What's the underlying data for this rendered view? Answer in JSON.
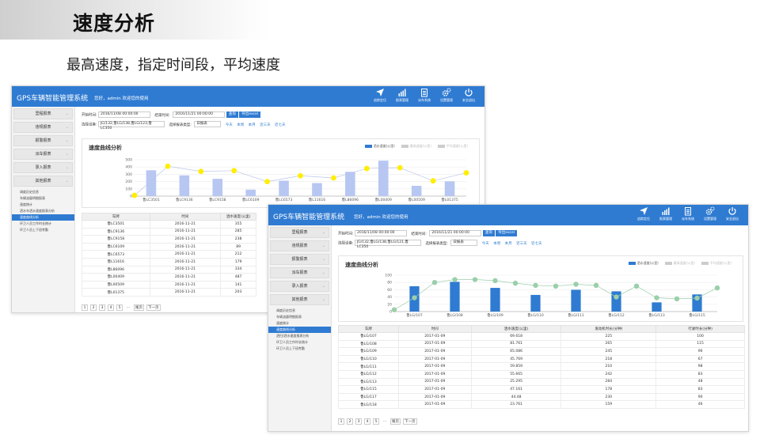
{
  "promo": {
    "title": "速度分析",
    "subtitle": "最高速度，指定时间段，平均速度"
  },
  "colors": {
    "header_blue": "#2f7bd2",
    "bar_light": "#b7c7f2",
    "bar_blue": "#2f7bd2",
    "dot_yellow": "#ffee00",
    "dot_green": "#9acfaa"
  },
  "back_app": {
    "brand": "GPS车辆智能管理系统",
    "welcome": "您好，admin 欢迎您的使用",
    "nav": [
      {
        "label": "追踪定位",
        "icon": "location-arrow-icon"
      },
      {
        "label": "报表管理",
        "icon": "bar-chart-icon"
      },
      {
        "label": "派车系统",
        "icon": "clipboard-icon"
      },
      {
        "label": "设置管理",
        "icon": "gears-icon"
      },
      {
        "label": "安全退出",
        "icon": "power-icon"
      }
    ],
    "menu": [
      "里程报表",
      "违规报表",
      "报警报表",
      "派车报表",
      "录入报表",
      "其他报表"
    ],
    "submenu": [
      "调度历史信息",
      "车辆油量明细报表",
      "速度统计",
      "洒水车洒水速度报表分析",
      "速度曲线分析",
      "环卫人员工作时长统计",
      "环卫人员上下班考勤"
    ],
    "active_submenu_index": 4,
    "filter": {
      "start_label": "开始时间:",
      "start_value": "2016/11/08 00:00:00",
      "end_label": "结束时间:",
      "end_value": "2016/11/21 00:00:00",
      "query_label": "查询",
      "export_label": "导出excel",
      "device_label": "选择设备:",
      "device_value": "JG/132,鲁LG/138,鲁LG/123,鲁LC350",
      "type_label": "选择报表类型:",
      "type_value": "日报表",
      "quick": [
        "今天",
        "本周",
        "本月",
        "近三天",
        "近七天"
      ]
    },
    "chart_title": "速度曲线分析",
    "legend": [
      "洒水速度(公里)",
      "最高速度(公里)",
      "平均速度(公里)"
    ],
    "table_headers": [
      "车牌",
      "时间",
      "洒水速度(公里)"
    ],
    "table_rows": [
      [
        "鲁LC3501",
        "2016-11-21",
        "355"
      ],
      [
        "鲁LC9136",
        "2016-11-21",
        "285"
      ],
      [
        "鲁LC9158",
        "2016-11-21",
        "238"
      ],
      [
        "鲁LC6109",
        "2016-11-21",
        "89"
      ],
      [
        "鲁LC6573",
        "2016-11-21",
        "212"
      ],
      [
        "鲁L11616",
        "2016-11-21",
        "179"
      ],
      [
        "鲁L86096",
        "2016-11-21",
        "334"
      ],
      [
        "鲁L00409",
        "2016-11-21",
        "487"
      ],
      [
        "鲁L00509",
        "2016-11-21",
        "141"
      ],
      [
        "鲁L01375",
        "2016-11-21",
        "203"
      ]
    ],
    "pager": [
      "1",
      "2",
      "3",
      "4",
      "5",
      "...",
      "尾页",
      "下一页"
    ]
  },
  "front_app": {
    "brand": "GPS车辆智能管理系统",
    "welcome": "您好，admin 欢迎您的使用",
    "nav": [
      {
        "label": "追踪定位",
        "icon": "location-arrow-icon"
      },
      {
        "label": "报表管理",
        "icon": "bar-chart-icon"
      },
      {
        "label": "派车系统",
        "icon": "clipboard-icon"
      },
      {
        "label": "设置管理",
        "icon": "gears-icon"
      },
      {
        "label": "安全退出",
        "icon": "power-icon"
      }
    ],
    "menu": [
      "里程报表",
      "违规报表",
      "报警报表",
      "派车报表",
      "录入报表",
      "其他报表"
    ],
    "submenu": [
      "调度历史信息",
      "车辆油量明细报表",
      "速度统计",
      "速度曲线分析",
      "洒扫/洒水速度报表分析",
      "环卫人员工作时长统计",
      "环卫人员上下班考勤"
    ],
    "active_submenu_index": 3,
    "filter": {
      "start_label": "开始时间:",
      "start_value": "2016/11/08 00:00:00",
      "end_label": "结束时间:",
      "end_value": "2016/11/21 00:00:00",
      "query_label": "查询",
      "export_label": "导出excel",
      "device_label": "选择设备:",
      "device_value": "JG/132,鲁LG/138,鲁LG/121,鲁LC350",
      "type_label": "选择报表类型:",
      "type_value": "日报表",
      "quick": [
        "今天",
        "本周",
        "本月",
        "近三天",
        "近七天"
      ]
    },
    "chart_title": "速度曲线分析",
    "legend": [
      "洒水速度(公里)",
      "最高速度(公里)",
      "平均速度(公里)"
    ],
    "table_headers": [
      "车牌",
      "时间",
      "洒水速度(公里)",
      "发动机时长(分钟)",
      "行驶时长(分钟)"
    ],
    "table_rows": [
      [
        "鲁LG/107",
        "2017-01-09",
        "69.618",
        "225",
        "100"
      ],
      [
        "鲁LG/108",
        "2017-01-09",
        "81.761",
        "265",
        "115"
      ],
      [
        "鲁LG/109",
        "2017-01-09",
        "65.086",
        "245",
        "96"
      ],
      [
        "鲁LG/110",
        "2017-01-09",
        "45.769",
        "218",
        "67"
      ],
      [
        "鲁LG/111",
        "2017-01-09",
        "59.859",
        "210",
        "98"
      ],
      [
        "鲁LG/112",
        "2017-01-09",
        "55.665",
        "242",
        "83"
      ],
      [
        "鲁LG/113",
        "2017-01-09",
        "25.295",
        "284",
        "48"
      ],
      [
        "鲁LG/115",
        "2017-01-09",
        "47.161",
        "178",
        "83"
      ],
      [
        "鲁LG/117",
        "2017-01-09",
        "44.48",
        "230",
        "90"
      ],
      [
        "鲁LG/118",
        "2017-01-09",
        "23.761",
        "159",
        "46"
      ]
    ],
    "pager": [
      "1",
      "2",
      "3",
      "4",
      "5",
      "...",
      "尾页",
      "下一页"
    ]
  },
  "chart_data": [
    {
      "type": "bar",
      "categories": [
        "鲁LC3501",
        "鲁LC9136",
        "鲁LC9158",
        "鲁LC6109",
        "鲁LC6573",
        "鲁L11616",
        "鲁L86096",
        "鲁L00409",
        "鲁L00509",
        "鲁L01375"
      ],
      "series": [
        {
          "name": "洒水速度(公里)",
          "values": [
            355,
            285,
            238,
            89,
            212,
            179,
            334,
            487,
            141,
            203
          ]
        }
      ],
      "markers": [
        10,
        410,
        340,
        350,
        200,
        280,
        250,
        380,
        390,
        210,
        320
      ],
      "ylim": [
        0,
        500
      ],
      "yticks": [
        0,
        100,
        200,
        300,
        400,
        500
      ],
      "legend": [
        "洒水速度(公里)",
        "最高速度(公里)",
        "平均速度(公里)"
      ],
      "title": "速度曲线分析"
    },
    {
      "type": "bar",
      "categories": [
        "鲁LG/107",
        "鲁LG/108",
        "鲁LG/109",
        "鲁LG/110",
        "鲁LG/111",
        "鲁LG/112",
        "鲁LG/113",
        "鲁LG/115"
      ],
      "series": [
        {
          "name": "洒水速度(公里)",
          "values": [
            69.618,
            81.761,
            65.086,
            45.769,
            59.859,
            55.665,
            25.295,
            47.161
          ]
        }
      ],
      "markers": [
        5,
        38,
        80,
        88,
        88,
        85,
        78,
        72,
        70,
        75,
        72,
        40,
        70,
        38,
        35,
        37,
        65
      ],
      "ylim": [
        0,
        100
      ],
      "yticks": [
        0,
        20,
        40,
        60,
        80,
        100
      ],
      "legend": [
        "洒水速度(公里)",
        "最高速度(公里)",
        "平均速度(公里)"
      ],
      "title": "速度曲线分析"
    }
  ]
}
